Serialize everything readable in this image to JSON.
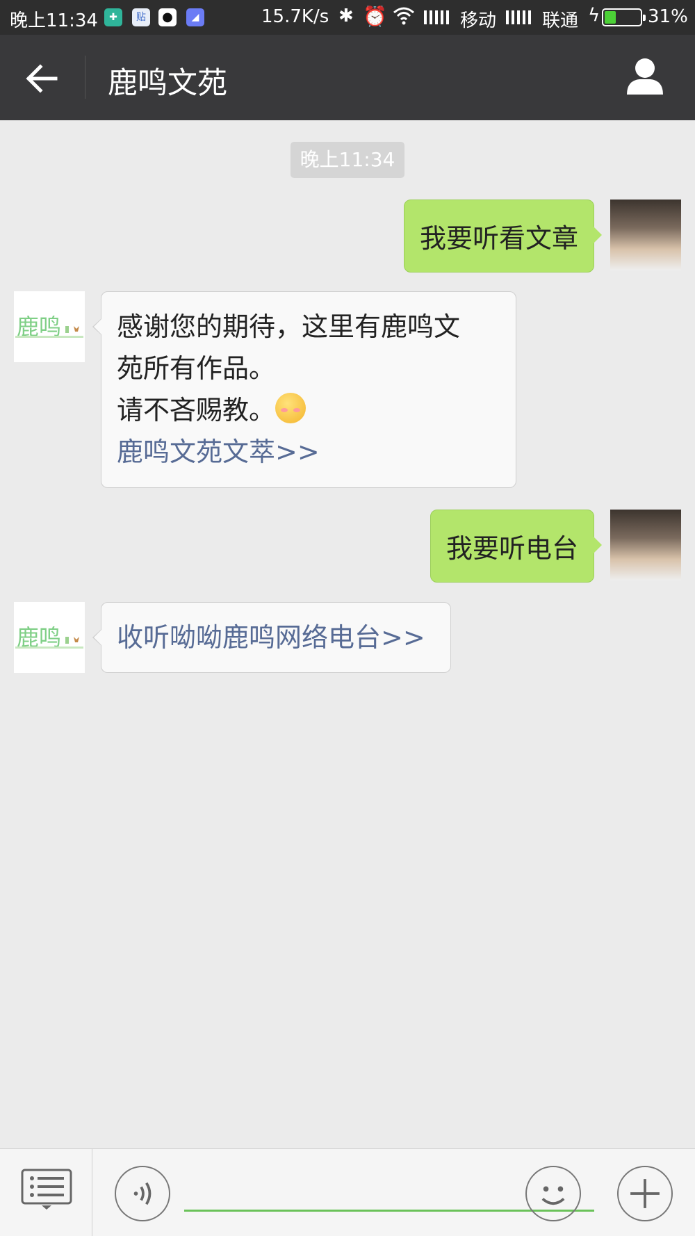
{
  "status_bar": {
    "time": "晚上11:34",
    "notif_badge": "贴",
    "net_speed": "15.7K/s",
    "carrier1": "移动",
    "carrier2": "联通",
    "battery_pct": "31%",
    "battery_level": 0.31,
    "icons": [
      "shield-app-icon",
      "tieba-app-icon",
      "qq-icon",
      "app-icon",
      "bluetooth-icon",
      "alarm-icon",
      "wifi-icon",
      "signal-icon",
      "charging-icon",
      "battery-icon"
    ]
  },
  "header": {
    "title": "鹿鸣文苑",
    "back_icon": "arrow-left-icon",
    "profile_icon": "person-icon"
  },
  "chat": {
    "timestamp": "晚上11:34",
    "messages": [
      {
        "from": "me",
        "text": "我要听看文章"
      },
      {
        "from": "account",
        "lines": [
          "感谢您的期待，这里有鹿鸣文",
          "苑所有作品。",
          "请不吝赐教。"
        ],
        "emoji": "smiling-blush-emoji",
        "link": "鹿鸣文苑文萃>>"
      },
      {
        "from": "me",
        "text": "我要听电台"
      },
      {
        "from": "account",
        "link": "收听呦呦鹿鸣网络电台>>"
      }
    ],
    "account_avatar_text": "鹿鸣"
  },
  "input_bar": {
    "menu_icon": "list-menu-icon",
    "voice_icon": "voice-icon",
    "emoji_icon": "emoji-icon",
    "plus_icon": "plus-icon",
    "value": ""
  },
  "colors": {
    "status_bar_bg": "#2e2e2e",
    "title_bar_bg": "#39393b",
    "chat_bg": "#ebebeb",
    "outgoing_bubble": "#b3e56b",
    "incoming_bubble": "#f9f9f9",
    "link": "#576b95",
    "input_underline": "#6ac259"
  }
}
